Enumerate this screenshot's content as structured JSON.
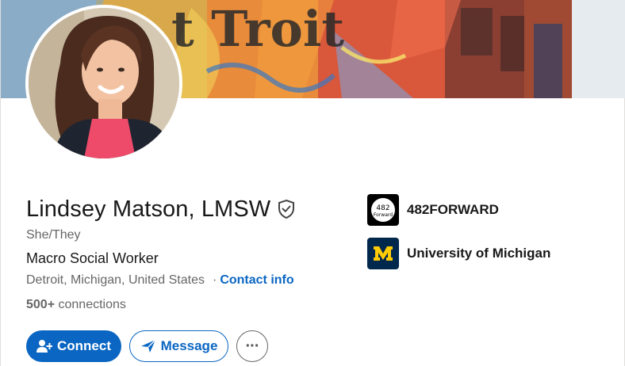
{
  "profile": {
    "name": "Lindsey Matson, LMSW",
    "verified_icon": "shield-check-icon",
    "pronouns": "She/They",
    "headline": "Macro Social Worker",
    "location": "Detroit, Michigan, United States",
    "separator": "·",
    "contact_info_label": "Contact info",
    "connections_count": "500+",
    "connections_label": "connections"
  },
  "cover": {
    "description_icon": "mural-cover-image"
  },
  "organizations": [
    {
      "name": "482FORWARD",
      "logo_text_top": "482",
      "logo_text_bottom": "Forward"
    },
    {
      "name": "University of Michigan",
      "logo_letter": "M"
    }
  ],
  "actions": {
    "connect_label": "Connect",
    "message_label": "Message",
    "more_label": "···"
  },
  "colors": {
    "accent": "#0a66c2",
    "text_primary": "#191919",
    "text_secondary": "#666666",
    "umich_navy": "#00274c",
    "umich_maize": "#ffcb05"
  }
}
